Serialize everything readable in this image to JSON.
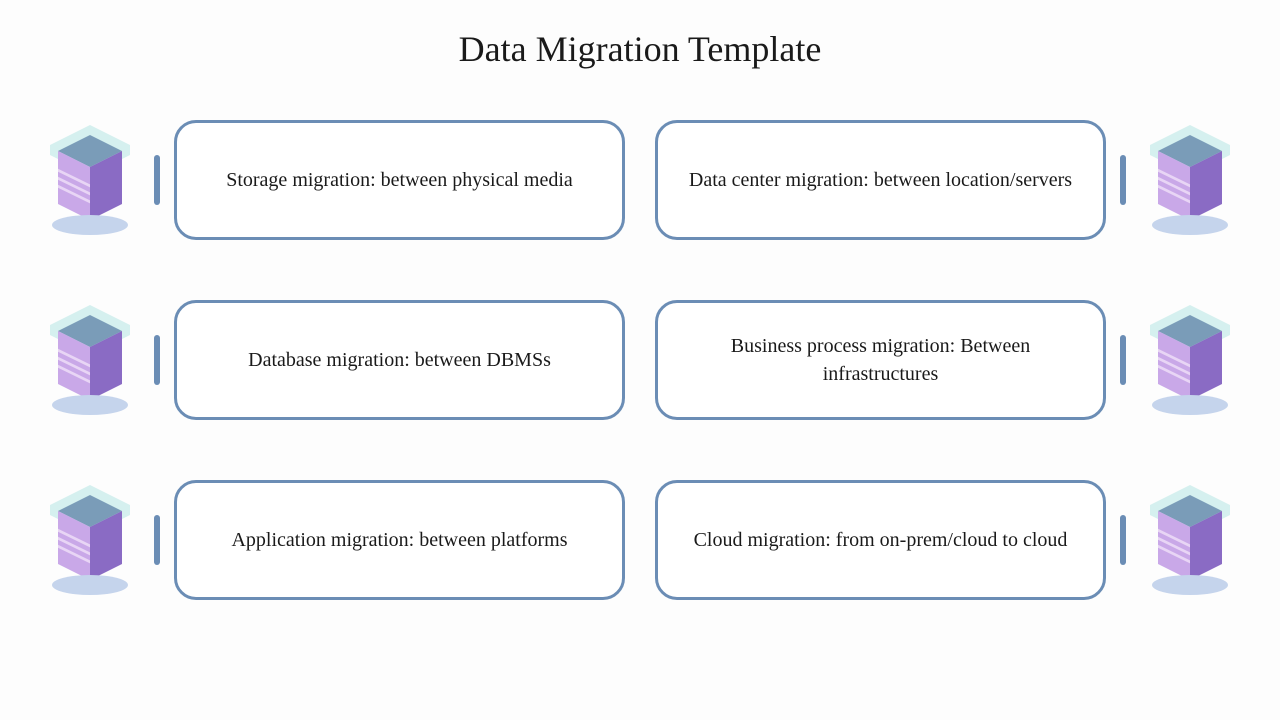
{
  "title": "Data Migration Template",
  "items": [
    {
      "text": "Storage migration: between physical media"
    },
    {
      "text": "Data center migration: between location/servers"
    },
    {
      "text": "Database migration: between DBMSs"
    },
    {
      "text": "Business process migration: Between infrastructures"
    },
    {
      "text": "Application migration: between platforms"
    },
    {
      "text": "Cloud migration: from on-prem/cloud to cloud"
    }
  ]
}
